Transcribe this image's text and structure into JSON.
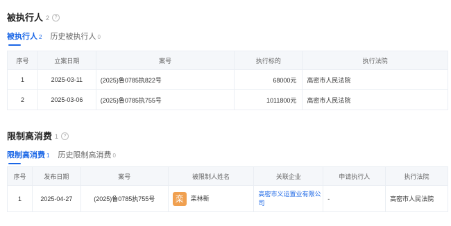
{
  "executed": {
    "title": "被执行人",
    "count": "2",
    "help": "?",
    "tabs": [
      {
        "label": "被执行人",
        "count": "2"
      },
      {
        "label": "历史被执行人",
        "count": "0"
      }
    ],
    "columns": [
      "序号",
      "立案日期",
      "案号",
      "执行标的",
      "执行法院"
    ],
    "rows": [
      [
        "1",
        "2025-03-11",
        "(2025)鲁0785执822号",
        "68000元",
        "高密市人民法院"
      ],
      [
        "2",
        "2025-03-06",
        "(2025)鲁0785执755号",
        "1011800元",
        "高密市人民法院"
      ]
    ]
  },
  "consumption": {
    "title": "限制高消费",
    "count": "1",
    "help": "?",
    "tabs": [
      {
        "label": "限制高消费",
        "count": "1"
      },
      {
        "label": "历史限制高消费",
        "count": "0"
      }
    ],
    "columns": [
      "序号",
      "发布日期",
      "案号",
      "被限制人姓名",
      "关联企业",
      "申请执行人",
      "执行法院"
    ],
    "rows": [
      {
        "index": "1",
        "date": "2025-04-27",
        "case_no": "(2025)鲁0785执755号",
        "avatar_char": "栾",
        "avatar_color": "#f0a050",
        "name": "栾林新",
        "company": "高密市义运置业有限公司",
        "applicant": "-",
        "court": "高密市人民法院"
      }
    ]
  }
}
